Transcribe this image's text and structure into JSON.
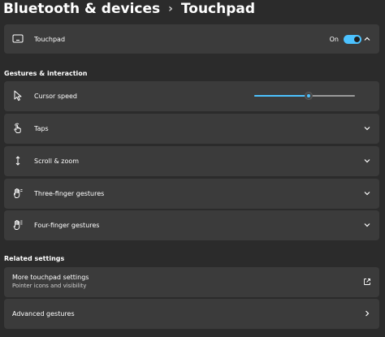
{
  "breadcrumb": {
    "parent": "Bluetooth & devices",
    "separator": "›",
    "current": "Touchpad"
  },
  "touchpad_row": {
    "label": "Touchpad",
    "icon": "touchpad-icon",
    "toggle_text": "On",
    "toggle_on": true
  },
  "sections": {
    "gestures": "Gestures & interaction",
    "related": "Related settings"
  },
  "cursor_speed": {
    "label": "Cursor speed",
    "icon": "cursor-icon",
    "value_fraction": 0.54
  },
  "rows": [
    {
      "label": "Taps",
      "icon": "tap-hand-icon"
    },
    {
      "label": "Scroll & zoom",
      "icon": "scroll-arrows-icon"
    },
    {
      "label": "Three-finger gestures",
      "icon": "three-finger-hand-icon"
    },
    {
      "label": "Four-finger gestures",
      "icon": "four-finger-hand-icon"
    }
  ],
  "related": {
    "more_settings": {
      "label": "More touchpad settings",
      "sublabel": "Pointer icons and visibility",
      "icon": "open-external-icon"
    },
    "advanced": {
      "label": "Advanced gestures",
      "icon": "chevron-right-icon"
    }
  },
  "colors": {
    "accent": "#4cc2ff",
    "background": "#2b2b2b",
    "card": "#3b3b3b"
  }
}
